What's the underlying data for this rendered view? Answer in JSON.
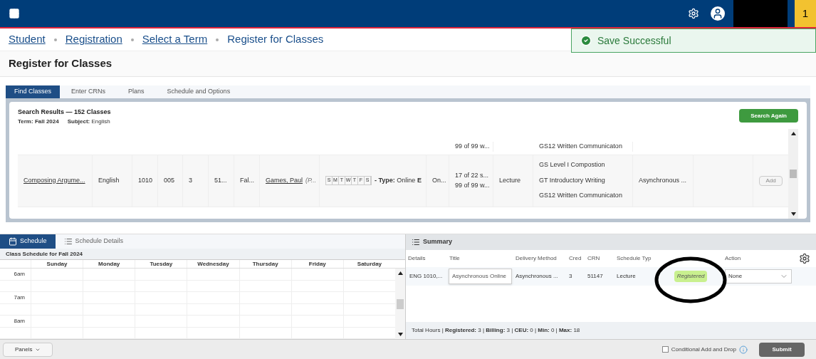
{
  "topbar": {
    "badge": "1"
  },
  "breadcrumbs": [
    {
      "label": "Student",
      "link": true
    },
    {
      "label": "Registration",
      "link": true
    },
    {
      "label": "Select a Term",
      "link": true
    },
    {
      "label": "Register for Classes",
      "link": false
    }
  ],
  "notification": {
    "message": "Save Successful"
  },
  "page_title": "Register for Classes",
  "tabs": [
    {
      "label": "Find Classes",
      "selected": true
    },
    {
      "label": "Enter CRNs",
      "selected": false
    },
    {
      "label": "Plans",
      "selected": false
    },
    {
      "label": "Schedule and Options",
      "selected": false
    }
  ],
  "search_results": {
    "heading": "Search Results — 152 Classes",
    "term_label": "Term:",
    "term": "Fall 2024",
    "subject_label": "Subject:",
    "subject": "English",
    "search_again": "Search Again",
    "rows": [
      {
        "partial": true,
        "title": "",
        "subject": "",
        "course": "",
        "section": "",
        "hours": "",
        "crn": "",
        "term": "",
        "instructor": "",
        "days": [],
        "type_label": "",
        "type": "",
        "campus": "",
        "status": [
          "99 of 99 w..."
        ],
        "schedule_type": "",
        "attributes": [
          "GS12 Written Communicaton"
        ],
        "delivery": "",
        "add": ""
      },
      {
        "partial": false,
        "title": "Composing Argume...",
        "subject": "English",
        "course": "1010",
        "section": "005",
        "hours": "3",
        "crn": "51...",
        "term": "Fal...",
        "instructor": "Games, Paul",
        "instructor_extra": "(P...",
        "days": [
          "S",
          "M",
          "T",
          "W",
          "T",
          "F",
          "S"
        ],
        "type_label": "- Type:",
        "type": "Online",
        "type_extra": "E",
        "campus": "On...",
        "status": [
          "17 of 22 s...",
          "99 of 99 w..."
        ],
        "schedule_type": "Lecture",
        "attributes": [
          "GS Level I Compostion",
          "GT Introductory Writing",
          "GS12 Written Communicaton"
        ],
        "delivery": "Asynchronous ...",
        "add": "Add"
      }
    ]
  },
  "schedule": {
    "tabs": [
      {
        "label": "Schedule",
        "selected": true
      },
      {
        "label": "Schedule Details",
        "selected": false
      }
    ],
    "title": "Class Schedule for Fall 2024",
    "days": [
      "Sunday",
      "Monday",
      "Tuesday",
      "Wednesday",
      "Thursday",
      "Friday",
      "Saturday"
    ],
    "times": [
      "6am",
      "7am",
      "8am"
    ]
  },
  "summary": {
    "title": "Summary",
    "columns": [
      "Details",
      "Title",
      "Delivery Method",
      "Cred",
      "CRN",
      "Schedule Typ",
      "",
      "Action"
    ],
    "rows": [
      {
        "details": "ENG 1010,...",
        "title": "Asynchronous Online",
        "delivery": "Asynchronous ...",
        "credits": "3",
        "crn": "51147",
        "schedule_type": "Lecture",
        "status": "Registered",
        "action": "None"
      }
    ],
    "totals": "Total Hours | **Registered:** 3 | **Billing:** 3 | **CEU:** 0 | **Min:** 0 | **Max:** 18"
  },
  "footer": {
    "panels": "Panels",
    "conditional": {
      "label": "Conditional Add and Drop",
      "checked": false
    },
    "submit": "Submit"
  }
}
